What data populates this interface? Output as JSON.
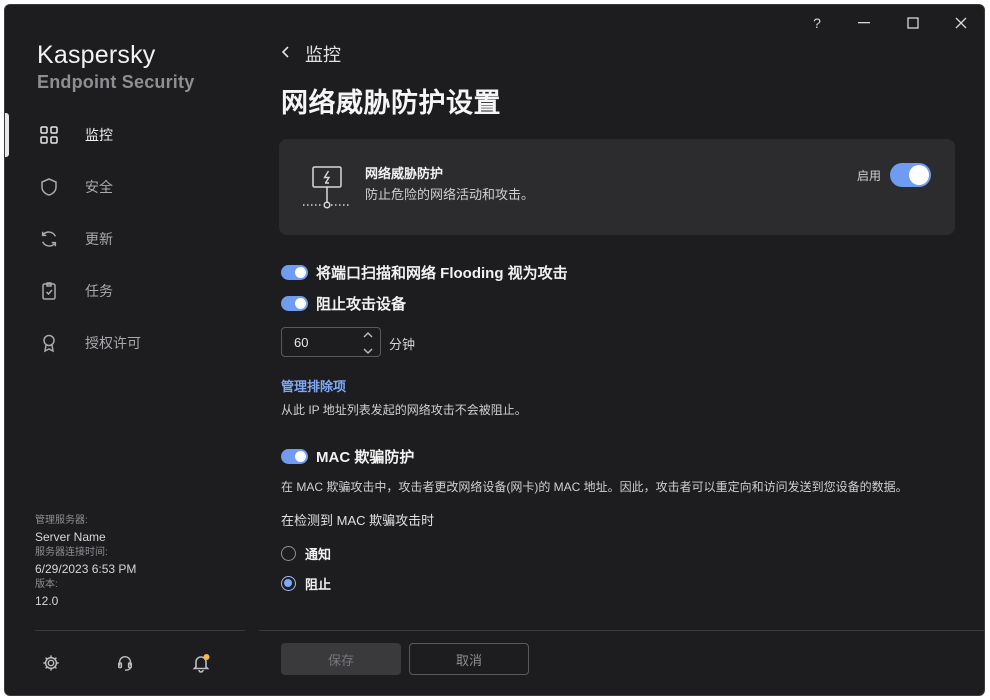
{
  "app": {
    "brand_name": "Kaspersky",
    "brand_sub": "Endpoint Security"
  },
  "titlebar": {
    "help": "?",
    "minimize": "—",
    "maximize": "☐",
    "close": "✕"
  },
  "sidebar": {
    "items": [
      {
        "label": "监控",
        "icon": "dashboard-icon",
        "active": true
      },
      {
        "label": "安全",
        "icon": "shield-icon"
      },
      {
        "label": "更新",
        "icon": "refresh-icon"
      },
      {
        "label": "任务",
        "icon": "clipboard-icon"
      },
      {
        "label": "授权许可",
        "icon": "award-icon"
      }
    ],
    "server": {
      "server_label": "管理服务器:",
      "server_value": "Server Name",
      "conn_label": "服务器连接时间:",
      "conn_value": "6/29/2023 6:53 PM",
      "version_label": "版本:",
      "version_value": "12.0"
    },
    "footer_icons": [
      "gear-icon",
      "support-icon",
      "notification-bell-icon"
    ]
  },
  "main": {
    "breadcrumb": "监控",
    "title": "网络威胁防护设置",
    "card": {
      "title": "网络威胁防护",
      "desc": "防止危险的网络活动和攻击。",
      "toggle_label": "启用",
      "enabled": true
    },
    "options": {
      "port_scan": {
        "label": "将端口扫描和网络 Flooding 视为攻击",
        "enabled": true
      },
      "block_attacker": {
        "label": "阻止攻击设备",
        "enabled": true
      }
    },
    "block_duration": {
      "value": "60",
      "unit": "分钟"
    },
    "exclusions": {
      "link": "管理排除项",
      "note": "从此 IP 地址列表发起的网络攻击不会被阻止。"
    },
    "mac": {
      "label": "MAC 欺骗防护",
      "enabled": true,
      "desc": "在 MAC 欺骗攻击中，攻击者更改网络设备(网卡)的 MAC 地址。因此，攻击者可以重定向和访问发送到您设备的数据。",
      "sub": "在检测到 MAC 欺骗攻击时",
      "radios": [
        {
          "label": "通知",
          "checked": false
        },
        {
          "label": "阻止",
          "checked": true
        }
      ]
    },
    "buttons": {
      "save": "保存",
      "cancel": "取消"
    }
  },
  "colors": {
    "accent": "#6f9bf0",
    "link": "#7fa8f5",
    "background": "#1d1d1f",
    "card": "#2c2c2e",
    "notification_dot": "#f2b84b"
  }
}
